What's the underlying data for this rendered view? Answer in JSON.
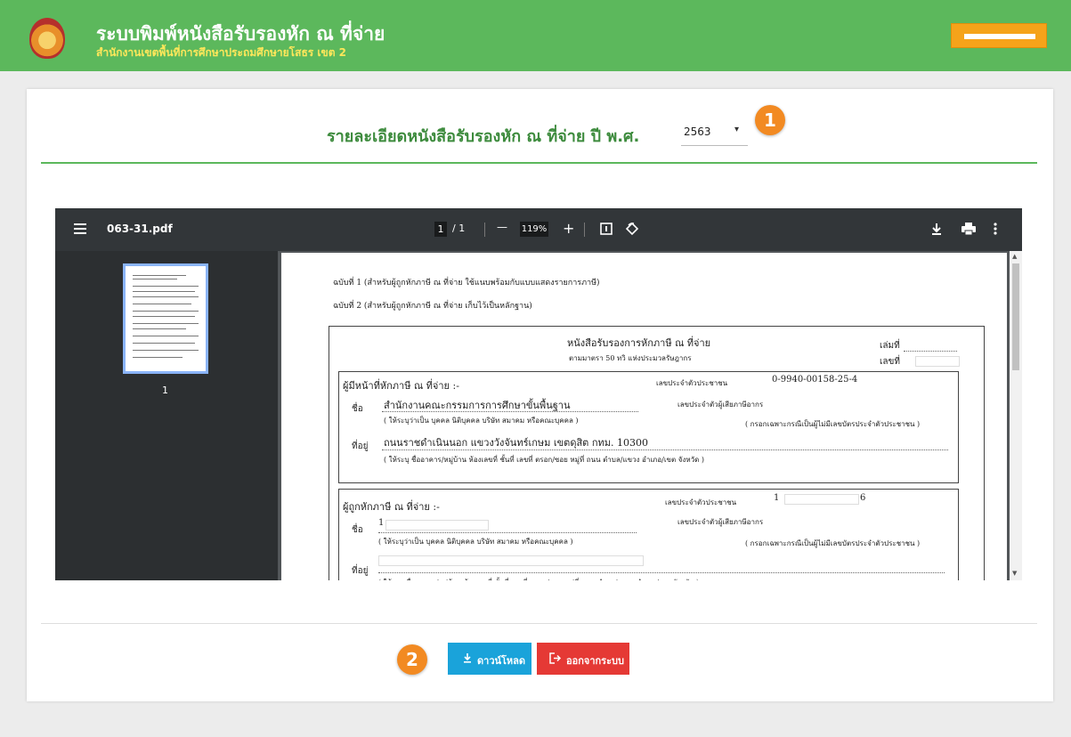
{
  "header": {
    "title": "ระบบพิมพ์หนังสือรับรองหัก ณ ที่จ่าย",
    "subtitle": "สำนักงานเขตพื้นที่การศึกษาประถมศึกษายโสธร เขต 2",
    "user_button_icon": "redacted-name-bar"
  },
  "main": {
    "heading": "รายละเอียดหนังสือรับรองหัก ณ ที่จ่าย ปี พ.ศ.",
    "year_value": "2563",
    "year_caret": "▾",
    "marker_1": "1",
    "marker_2": "2"
  },
  "viewer": {
    "file_name": "063-31.pdf",
    "page_current": "1",
    "page_total": "/ 1",
    "zoom_minus": "—",
    "zoom": "119%",
    "zoom_plus": "+",
    "thumb_page": "1",
    "icons": [
      "menu-icon",
      "fit-page-icon",
      "rotate-icon",
      "download-icon",
      "print-icon",
      "more-icon"
    ]
  },
  "document": {
    "copy1": "ฉบับที่ 1 (สำหรับผู้ถูกหักภาษี ณ ที่จ่าย ใช้แนบพร้อมกับแบบแสดงรายการภาษี)",
    "copy2": "ฉบับที่ 2 (สำหรับผู้ถูกหักภาษี ณ ที่จ่าย เก็บไว้เป็นหลักฐาน)",
    "title": "หนังสือรับรองการหักภาษี ณ ที่จ่าย",
    "law": "ตามมาตรา 50 ทวิ แห่งประมวลรัษฎากร",
    "book_no": "เล่มที่",
    "no": "เลขที่",
    "payer_header": "ผู้มีหน้าที่หักภาษี ณ ที่จ่าย :-",
    "id_label": "เลขประจำตัวประชาชน",
    "payer_id": "0-9940-00158-25-4",
    "name_label": "ชื่อ",
    "payer_name": "สำนักงานคณะกรรมการการศึกษาขั้นพื้นฐาน",
    "tax_id_label": "เลขประจำตัวผู้เสียภาษีอากร",
    "name_hint": "( ให้ระบุว่าเป็น บุคคล นิติบุคคล บริษัท สมาคม หรือคณะบุคคล )",
    "tax_hint": "( กรอกเฉพาะกรณีเป็นผู้ไม่มีเลขบัตรประจำตัวประชาชน )",
    "addr_label": "ที่อยู่",
    "payer_addr": "ถนนราชดำเนินนอก แขวงวังจันทร์เกษม เขตดุสิต กทม. 10300",
    "addr_hint": "( ให้ระบุ ชื่ออาคาร/หมู่บ้าน ห้องเลขที่ ชั้นที่ เลขที่ ตรอก/ซอย หมู่ที่ ถนน ตำบล/แขวง อำเภอ/เขต จังหวัด )",
    "payee_header": "ผู้ถูกหักภาษี ณ ที่จ่าย :-",
    "payee_id_start": "1",
    "payee_id_end": "6",
    "payee_name_start": "1"
  },
  "buttons": {
    "download": "ดาวน์โหลด",
    "logout": "ออกจากระบบ"
  },
  "colors": {
    "header": "#5cb85c",
    "accent": "#f28a22",
    "download": "#1aa3da",
    "logout": "#e53935"
  }
}
